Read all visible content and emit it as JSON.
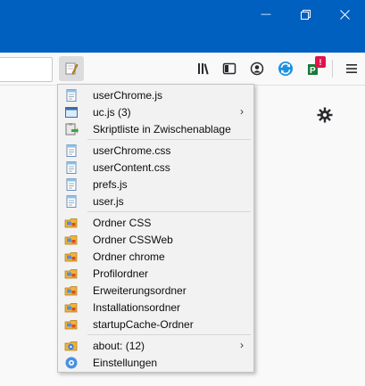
{
  "window": {
    "minimize_glyph": "—",
    "restore_glyph": "❐",
    "close_glyph": "✕"
  },
  "toolbar": {
    "buttons": [
      {
        "name": "library-icon"
      },
      {
        "name": "sidebar-icon"
      },
      {
        "name": "account-icon"
      },
      {
        "name": "sync-icon"
      },
      {
        "name": "extension-icon",
        "badge": "!"
      },
      {
        "name": "menu-icon"
      }
    ]
  },
  "menu": {
    "items": [
      {
        "label": "userChrome.js",
        "icon": "js-file-icon"
      },
      {
        "label": "uc.js (3)",
        "icon": "window-icon",
        "submenu": true
      },
      {
        "label": "Skriptliste in Zwischenablage",
        "icon": "clipboard-icon"
      },
      {
        "label": "userChrome.css",
        "icon": "css-file-icon"
      },
      {
        "label": "userContent.css",
        "icon": "css-file-icon"
      },
      {
        "label": "prefs.js",
        "icon": "js-file-icon"
      },
      {
        "label": "user.js",
        "icon": "js-file-icon"
      },
      {
        "label": "Ordner CSS",
        "icon": "folder-icon"
      },
      {
        "label": "Ordner CSSWeb",
        "icon": "folder-icon"
      },
      {
        "label": "Ordner chrome",
        "icon": "folder-icon"
      },
      {
        "label": "Profilordner",
        "icon": "folder-icon"
      },
      {
        "label": "Erweiterungsordner",
        "icon": "folder-icon"
      },
      {
        "label": "Installationsordner",
        "icon": "folder-icon"
      },
      {
        "label": "startupCache-Ordner",
        "icon": "folder-icon"
      },
      {
        "label": "about: (12)",
        "icon": "about-folder-icon",
        "submenu": true
      },
      {
        "label": "Einstellungen",
        "icon": "settings-icon"
      }
    ],
    "submenu_arrow": "›"
  },
  "colors": {
    "titlebar": "#0060c0",
    "toolbar": "#f9f9fa",
    "menu_bg": "#f2f2f2"
  }
}
